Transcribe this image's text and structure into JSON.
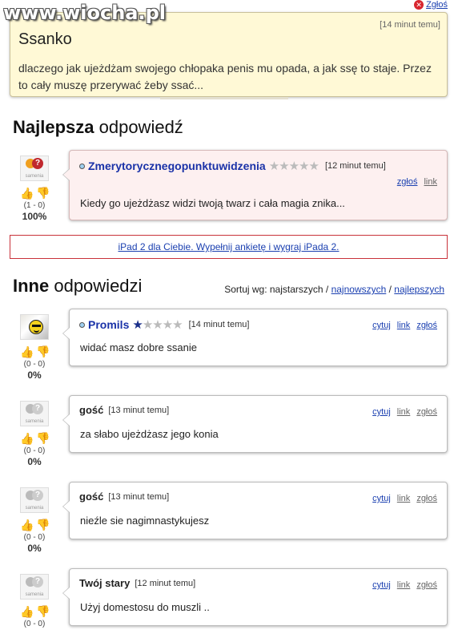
{
  "watermark": "www.wiocha.pl",
  "report_top": "Zgłoś",
  "question": {
    "time": "[14 minut temu]",
    "title": "Ssanko",
    "body": "dlaczego jak ujeżdżam swojego chłopaka penis mu opada, a jak ssę to staje. Przez to cały muszę przerywać żeby ssać..."
  },
  "best_section": {
    "bold": "Najlepsza",
    "rest": " odpowiedź"
  },
  "best_answer": {
    "author": "Zmerytorycznegopunktuwidzenia",
    "stars_on": 0,
    "time": "[12 minut temu]",
    "links": [
      "zgłoś",
      "link"
    ],
    "text": "Kiedy go ujeżdżasz widzi twoją twarz i cała magia znika...",
    "votes": "(1 - 0)",
    "percent": "100%"
  },
  "ad": {
    "text": "iPad 2 dla Ciebie. Wypełnij ankietę i wygraj iPada 2."
  },
  "other_section": {
    "bold": "Inne",
    "rest": " odpowiedzi"
  },
  "sort": {
    "label": "Sortuj wg: najstarszych / ",
    "newest": "najnowszych",
    "sep": " / ",
    "best": "najlepszych"
  },
  "answers": [
    {
      "author": "Promils",
      "stars_on": 1,
      "time": "[14 minut temu]",
      "links": [
        "cytuj",
        "link",
        "zgłoś"
      ],
      "text": "widać masz dobre ssanie",
      "votes": "(0 - 0)",
      "percent": "0%"
    },
    {
      "author": "gość",
      "time": "[13 minut temu]",
      "links": [
        "cytuj",
        "link",
        "zgłoś"
      ],
      "text": "za słabo ujeżdżasz jego konia",
      "votes": "(0 - 0)",
      "percent": "0%"
    },
    {
      "author": "gość",
      "time": "[13 minut temu]",
      "links": [
        "cytuj",
        "link",
        "zgłoś"
      ],
      "text": "nieźle sie nagimnastykujesz",
      "votes": "(0 - 0)",
      "percent": "0%"
    },
    {
      "author": "Twój stary",
      "time": "[12 minut temu]",
      "links": [
        "cytuj",
        "link",
        "zgłoś"
      ],
      "text": "Użyj domestosu do muszli ..",
      "votes": "(0 - 0)",
      "percent": ""
    }
  ],
  "avatar_label": "samenia",
  "star_glyph": "★",
  "colors": {
    "link": "#1a3fb0",
    "question_bg": "#fff9d6",
    "best_bg": "#fdf0f0",
    "ad_border": "#c8323a"
  }
}
